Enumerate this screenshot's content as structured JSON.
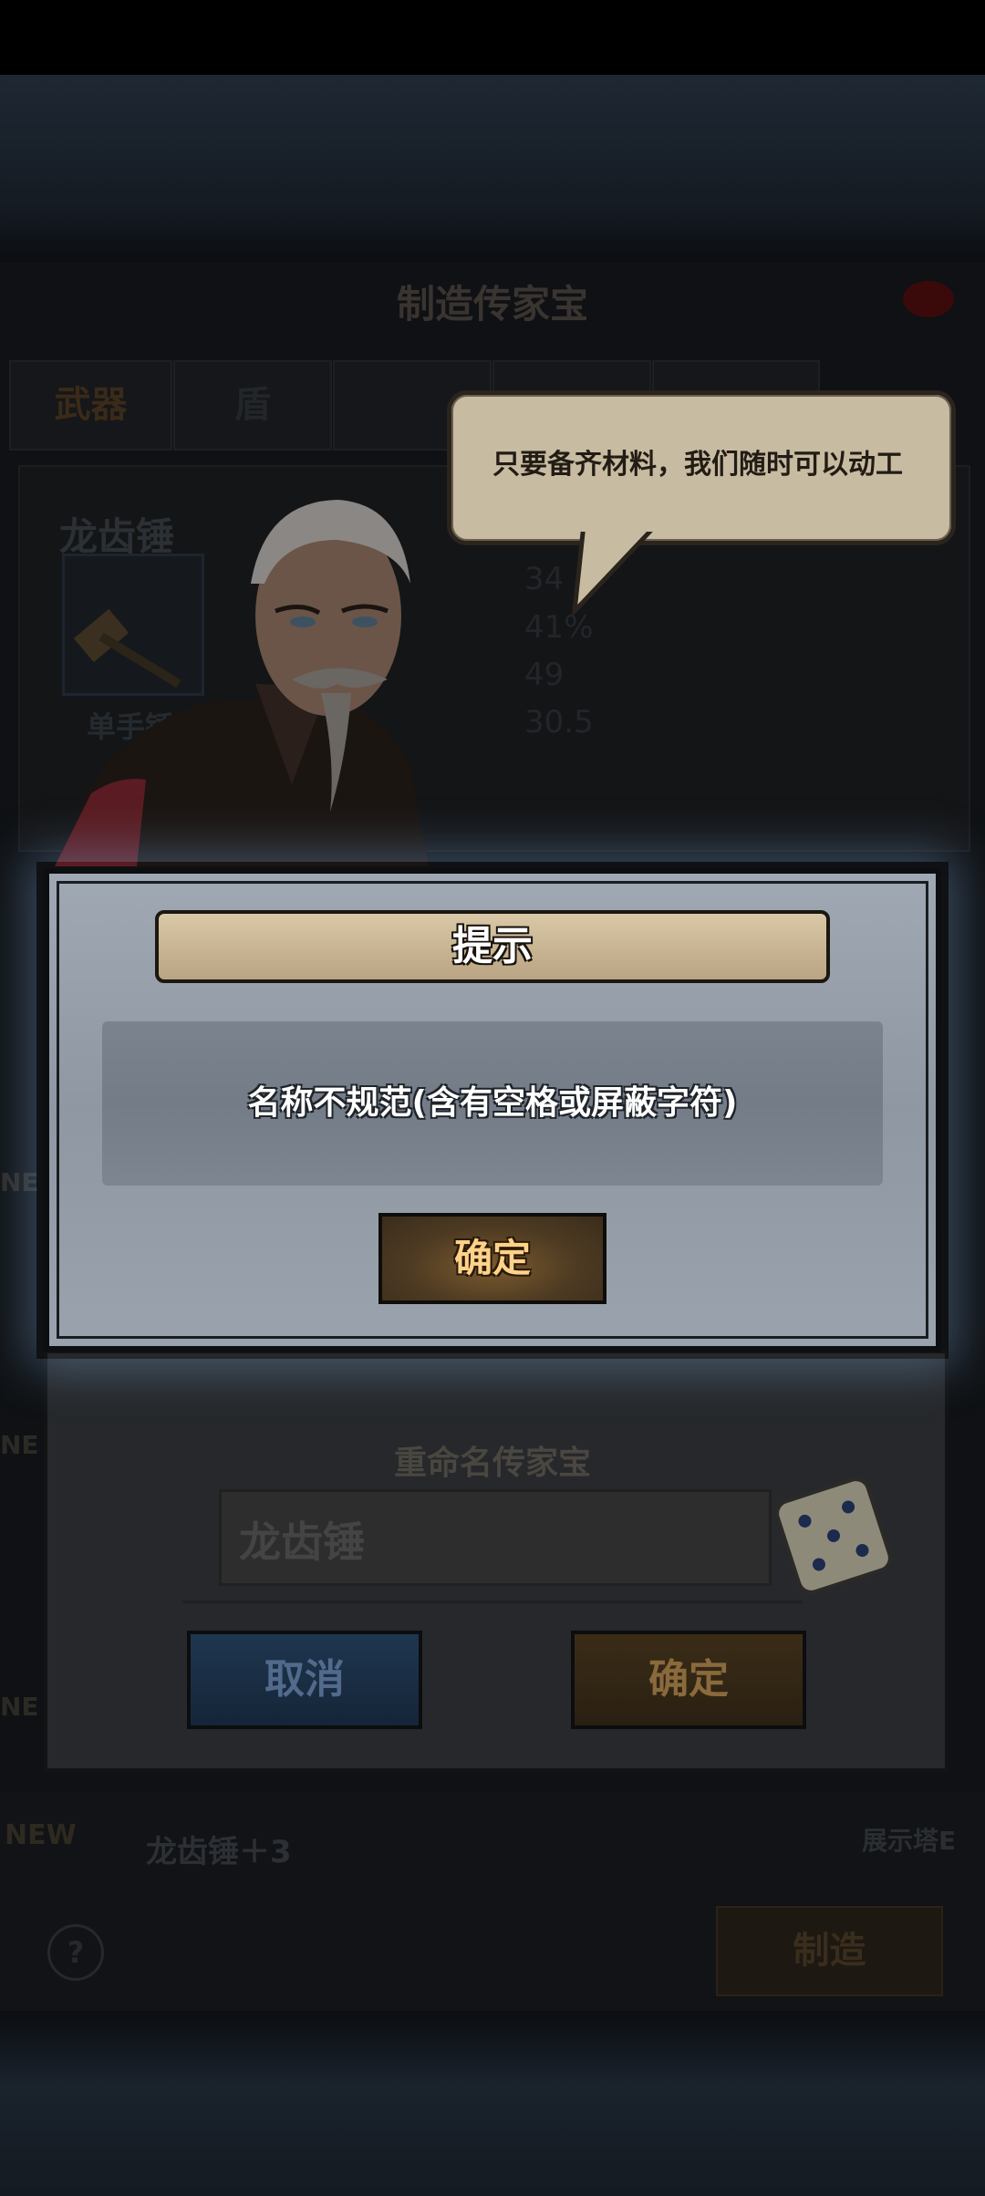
{
  "panel": {
    "title": "制造传家宝",
    "tabs": [
      {
        "label": "武器",
        "color": "#3a2a18"
      },
      {
        "label": "盾",
        "color": "#232629"
      },
      {
        "label": "",
        "color": "#232629"
      },
      {
        "label": "",
        "color": "#232629"
      },
      {
        "label": "",
        "color": "#232629"
      }
    ]
  },
  "npc": {
    "speech": "只要备齐材料，我们随时可以动工"
  },
  "item": {
    "name": "龙齿锤",
    "type": "单手锤",
    "stats": [
      "34",
      "41%",
      "49",
      "30.5"
    ]
  },
  "list": {
    "new_tags": [
      "NE",
      "NE",
      "NE"
    ],
    "bottom_new_tag": "NEW",
    "bottom_item_name": "龙齿锤＋3",
    "showcase_label": "展示塔E"
  },
  "footer": {
    "help_symbol": "?",
    "make_label": "制造"
  },
  "rename_dialog": {
    "title": "重命名传家宝",
    "input_value": "龙齿锤",
    "cancel_label": "取消",
    "confirm_label": "确定"
  },
  "alert": {
    "title": "提示",
    "message": "名称不规范(含有空格或屏蔽字符)",
    "confirm_label": "确定"
  }
}
